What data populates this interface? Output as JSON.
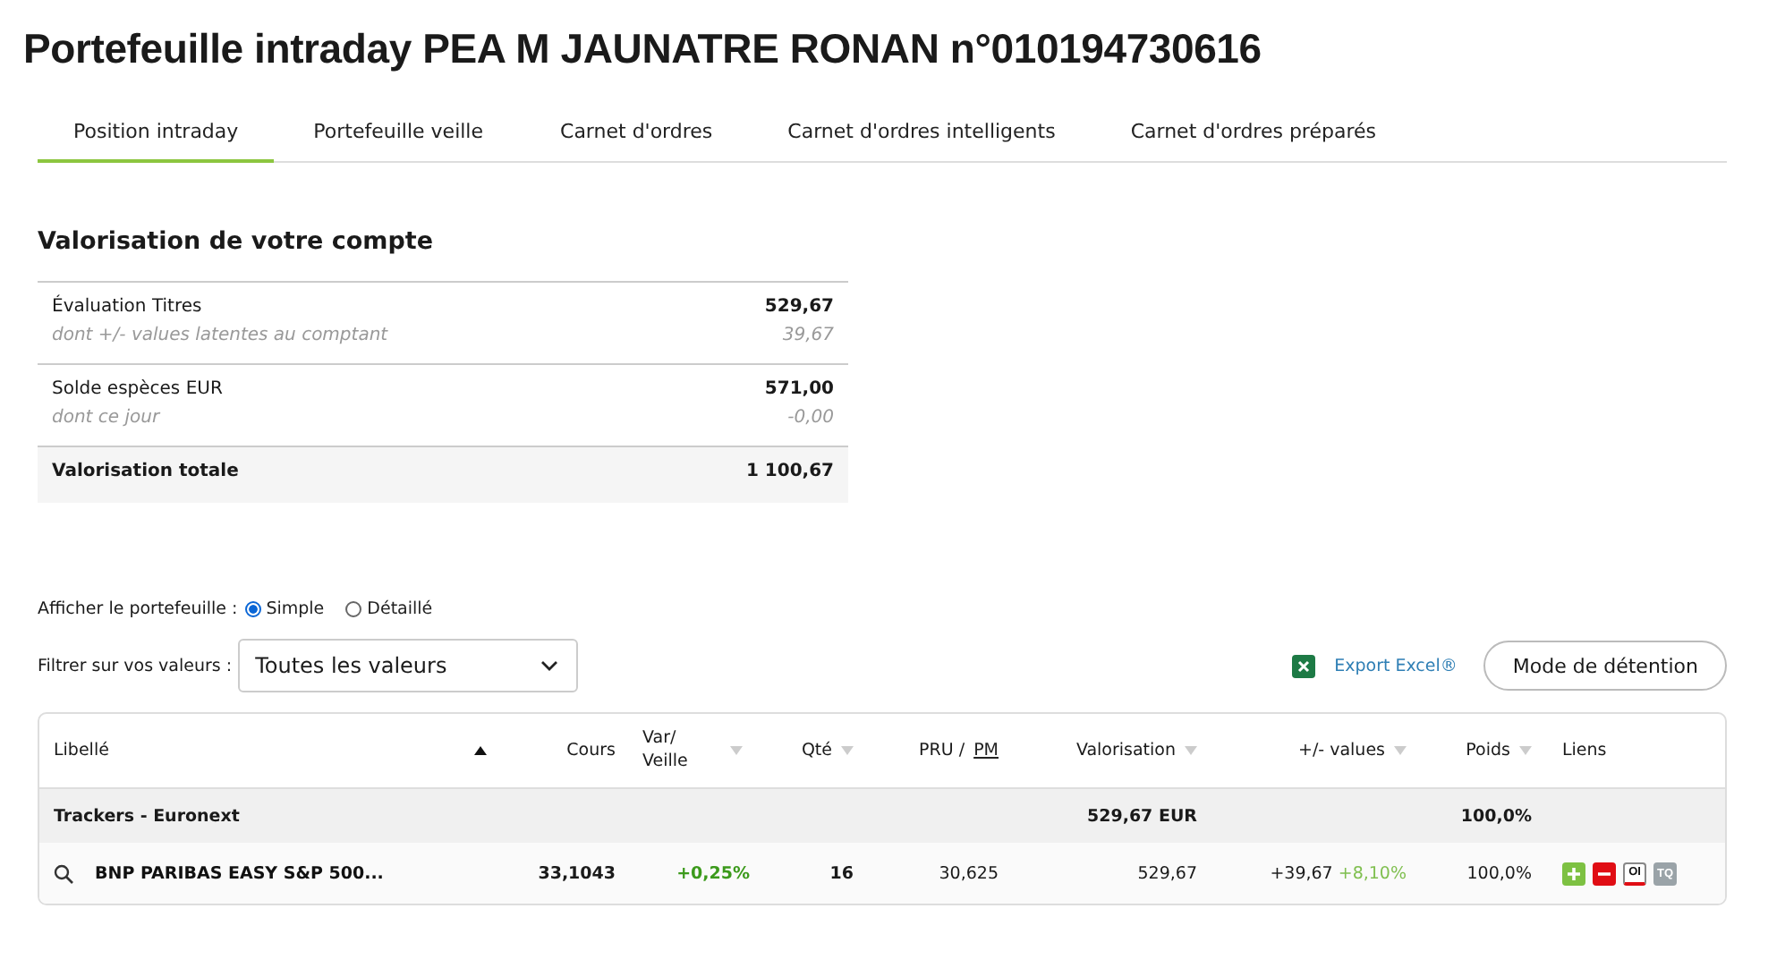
{
  "title": "Portefeuille intraday PEA M JAUNATRE RONAN n°010194730616",
  "tabs": [
    {
      "label": "Position intraday",
      "selected": true
    },
    {
      "label": "Portefeuille veille",
      "selected": false
    },
    {
      "label": "Carnet d'ordres",
      "selected": false
    },
    {
      "label": "Carnet d'ordres intelligents",
      "selected": false
    },
    {
      "label": "Carnet d'ordres préparés",
      "selected": false
    }
  ],
  "account": {
    "title": "Valorisation de votre compte",
    "groups": [
      {
        "label": "Évaluation Titres",
        "value": "529,67",
        "sub_label": "dont +/- values latentes au comptant",
        "sub_value": "39,67"
      },
      {
        "label": "Solde espèces EUR",
        "value": "571,00",
        "sub_label": "dont ce jour",
        "sub_value": "-0,00"
      }
    ],
    "total": {
      "label": "Valorisation totale",
      "value": "1 100,67"
    }
  },
  "display": {
    "label": "Afficher le portefeuille :",
    "options": [
      {
        "label": "Simple",
        "selected": true
      },
      {
        "label": "Détaillé",
        "selected": false
      }
    ]
  },
  "filter": {
    "label": "Filtrer sur vos valeurs :",
    "value": "Toutes les valeurs"
  },
  "export": {
    "label": "Export Excel®"
  },
  "mode_button": "Mode de détention",
  "table": {
    "columns": [
      {
        "label": "Libellé",
        "sortable": true,
        "sorted": true
      },
      {
        "label": "Cours",
        "sortable": false,
        "sorted": false
      },
      {
        "label": "Var/ Veille",
        "sortable": true,
        "sorted": false
      },
      {
        "label": "Qté",
        "sortable": true,
        "sorted": false
      },
      {
        "label": "PRU /",
        "link": "PM",
        "sortable": false,
        "sorted": false
      },
      {
        "label": "Valorisation",
        "sortable": true,
        "sorted": false
      },
      {
        "label": "+/- values",
        "sortable": true,
        "sorted": false
      },
      {
        "label": "Poids",
        "sortable": true,
        "sorted": false
      },
      {
        "label": "Liens",
        "sortable": false,
        "sorted": false
      }
    ],
    "groups": [
      {
        "name": "Trackers - Euronext",
        "valorisation": "529,67 EUR",
        "poids": "100,0%",
        "rows": [
          {
            "name": "BNP PARIBAS EASY S&P 500...",
            "cours": "33,1043",
            "var": "+0,25%",
            "qte": "16",
            "pru": "30,625",
            "valorisation": "529,67",
            "pv": "+39,67",
            "pv_pct": "+8,10%",
            "poids": "100,0%",
            "links": [
              {
                "kind": "buy"
              },
              {
                "kind": "sell"
              },
              {
                "kind": "oi",
                "label": "OI"
              },
              {
                "kind": "tq",
                "label": "TQ"
              }
            ]
          }
        ]
      }
    ]
  }
}
